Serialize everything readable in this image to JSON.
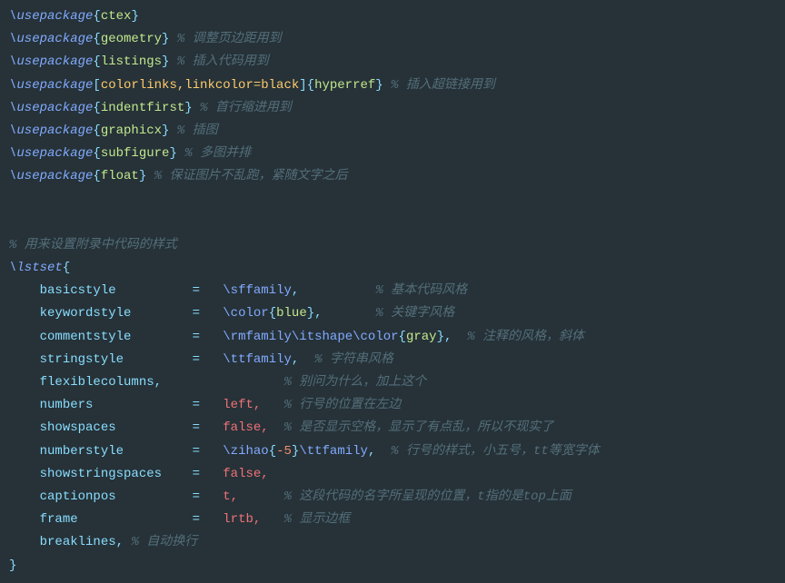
{
  "pkg": {
    "ctex": "ctex",
    "geometry": "geometry",
    "geometry_c": "% 调整页边距用到",
    "listings": "listings",
    "listings_c": "% 插入代码用到",
    "hyperref_opt": "colorlinks,linkcolor=black",
    "hyperref": "hyperref",
    "hyperref_c": "% 插入超链接用到",
    "indentfirst": "indentfirst",
    "indentfirst_c": "% 首行缩进用到",
    "graphicx": "graphicx",
    "graphicx_c": "% 插图",
    "subfigure": "subfigure",
    "subfigure_c": "% 多图并排",
    "float": "float",
    "float_c": "% 保证图片不乱跑，紧随文字之后"
  },
  "section_comment": "% 用来设置附录中代码的样式",
  "lstset": {
    "cmd": "\\lstset",
    "basicstyle": {
      "key": "basicstyle",
      "val": "\\sffamily",
      "c": "% 基本代码风格"
    },
    "keywordstyle": {
      "key": "keywordstyle",
      "val_cmd": "\\color",
      "val_arg": "blue",
      "c": "% 关键字风格"
    },
    "commentstyle": {
      "key": "commentstyle",
      "c": "% 注释的风格，斜体"
    },
    "commentstyle_parts": {
      "rm": "\\rmfamily",
      "it": "\\itshape",
      "col": "\\color",
      "arg": "gray"
    },
    "stringstyle": {
      "key": "stringstyle",
      "val": "\\ttfamily",
      "c": "% 字符串风格"
    },
    "flexiblecolumns": {
      "key": "flexiblecolumns,",
      "c": "% 别问为什么，加上这个"
    },
    "numbers": {
      "key": "numbers",
      "val": "left,",
      "c": "% 行号的位置在左边"
    },
    "showspaces": {
      "key": "showspaces",
      "val": "false,",
      "c": "% 是否显示空格，显示了有点乱，所以不现实了"
    },
    "numberstyle": {
      "key": "numberstyle",
      "c": "% 行号的样式，小五号，tt等宽字体"
    },
    "numberstyle_parts": {
      "zihao": "\\zihao",
      "num": "-5",
      "tt": "\\ttfamily"
    },
    "showstringspaces": {
      "key": "showstringspaces",
      "val": "false,"
    },
    "captionpos": {
      "key": "captionpos",
      "val": "t,",
      "c": "% 这段代码的名字所呈现的位置，t指的是top上面"
    },
    "frame": {
      "key": "frame",
      "val": "lrtb,",
      "c": "% 显示边框"
    },
    "breaklines": {
      "key": "breaklines,",
      "c": "% 自动换行"
    }
  },
  "usepackage": "\\usepackage"
}
